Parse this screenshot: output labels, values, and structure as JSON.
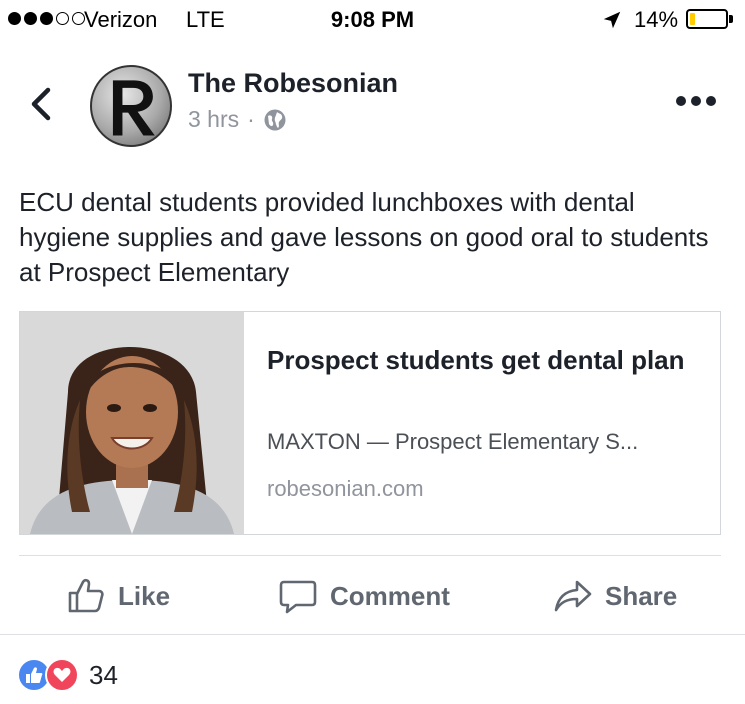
{
  "status_bar": {
    "carrier": "Verizon",
    "network": "LTE",
    "time": "9:08 PM",
    "battery_percent": "14%",
    "battery_level": 0.14,
    "signal_filled": 3,
    "signal_total": 5
  },
  "post": {
    "page_name": "The Robesonian",
    "timestamp": "3 hrs",
    "separator": "·",
    "text": "ECU dental students provided lunchboxes with dental hygiene supplies and gave lessons on good oral to students at Prospect Elementary",
    "icons": {
      "back": "chevron-left-icon",
      "privacy": "globe-icon",
      "more": "more-dots-icon"
    }
  },
  "link_card": {
    "title": "Prospect students get dental plan",
    "description": "MAXTON — Prospect Elementary S...",
    "domain": "robesonian.com"
  },
  "actions": {
    "like": "Like",
    "comment": "Comment",
    "share": "Share"
  },
  "reactions": {
    "count": "34",
    "types": [
      "like",
      "love"
    ]
  },
  "colors": {
    "text": "#1d2129",
    "secondary": "#90949c",
    "action_text": "#606770",
    "like_blue": "#4a87f0",
    "love_red": "#f0455a",
    "battery_low": "#ffcc00"
  }
}
